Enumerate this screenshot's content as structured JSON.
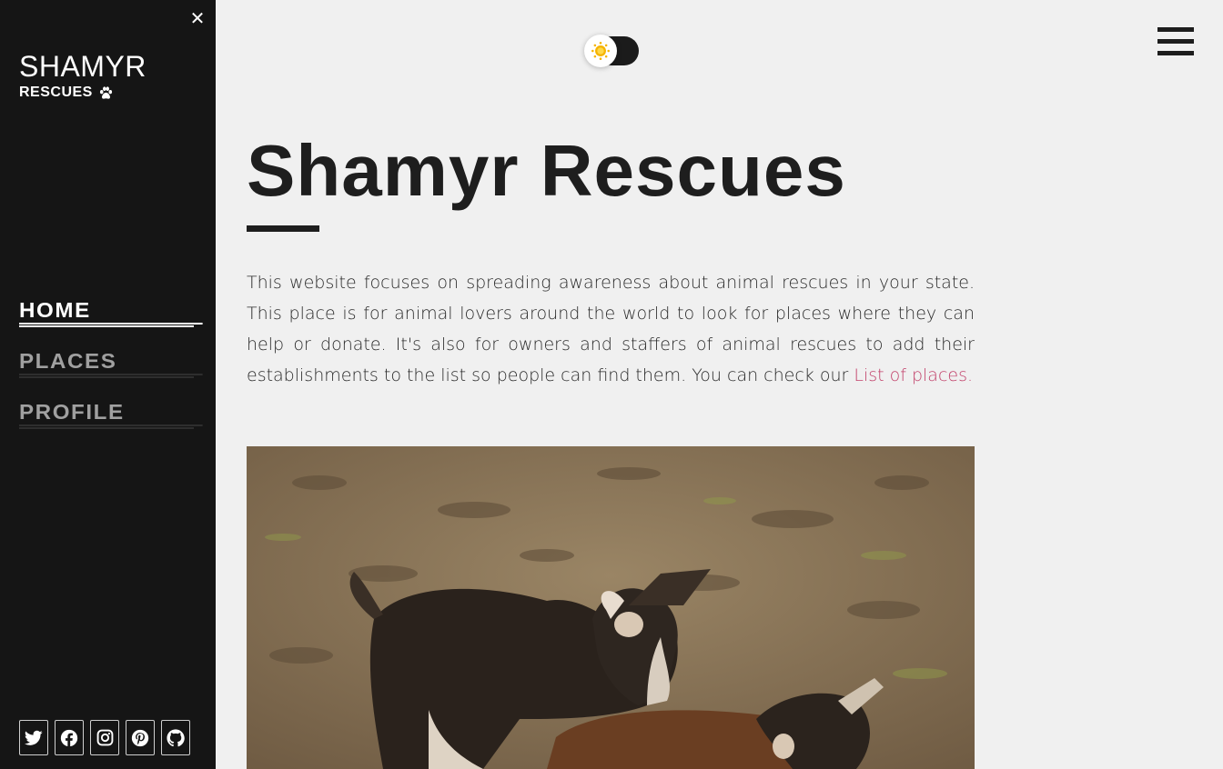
{
  "sidebar": {
    "close_icon": "close-icon",
    "brand_name": "SHAMYR",
    "brand_sub": "RESCUES",
    "brand_icon": "paw-icon",
    "nav": [
      {
        "label": "HOME",
        "active": true
      },
      {
        "label": "PLACES",
        "active": false
      },
      {
        "label": "PROFILE",
        "active": false
      }
    ],
    "socials": [
      "twitter-icon",
      "facebook-icon",
      "instagram-icon",
      "pinterest-icon",
      "github-icon"
    ]
  },
  "header": {
    "theme_toggle_icon": "sun-icon",
    "menu_icon": "hamburger-icon"
  },
  "main": {
    "title": "Shamyr Rescues",
    "intro_text": "This website focuses on spreading awareness about animal rescues in your state. This place is for animal lovers around the world to look for places where they can help or donate. It's also for owners and staffers of animal rescues to add their establishments to the list so people can find them. You can check our ",
    "intro_link": "List of places."
  },
  "colors": {
    "sidebar_bg": "#151515",
    "page_bg": "#f0f0f0",
    "link": "#c2426b",
    "sun": "#f5b400"
  }
}
